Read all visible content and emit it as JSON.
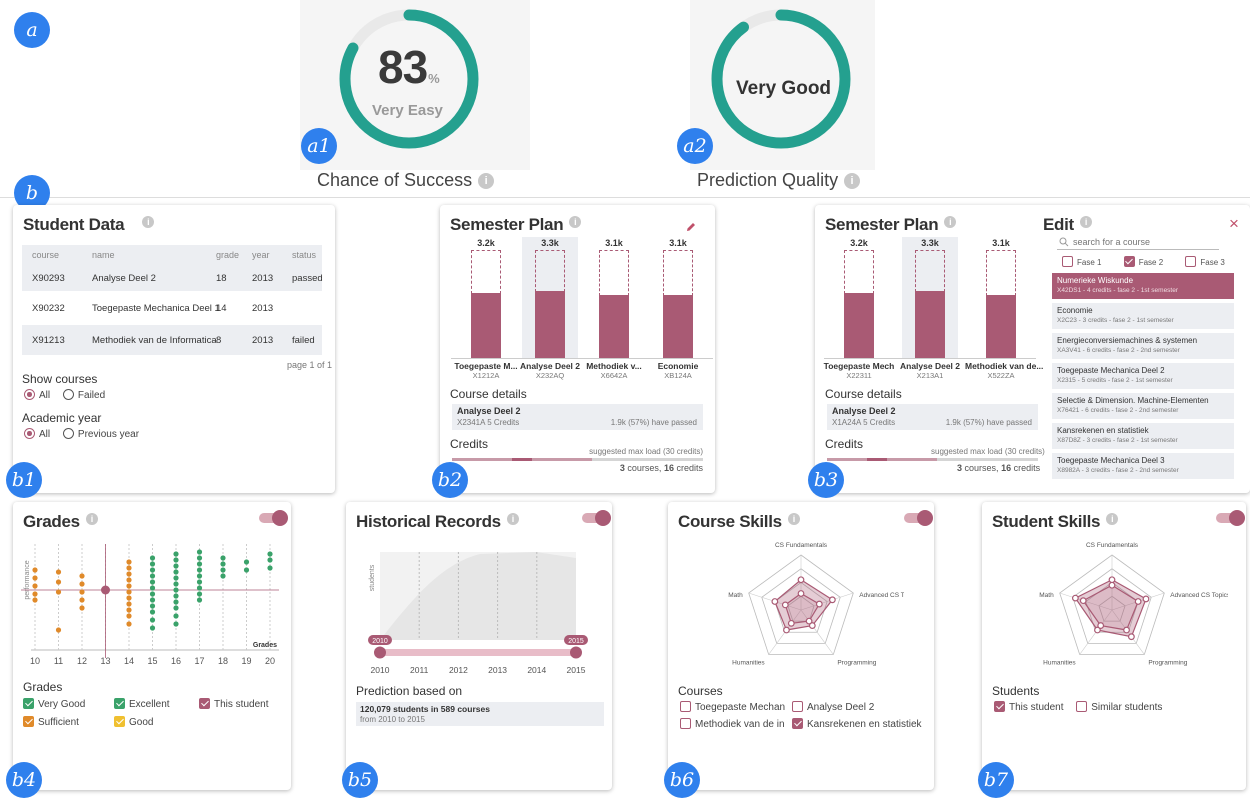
{
  "badges": {
    "a": "a",
    "a1": "a1",
    "a2": "a2",
    "b": "b",
    "b1": "b1",
    "b2": "b2",
    "b3": "b3",
    "b4": "b4",
    "b5": "b5",
    "b6": "b6",
    "b7": "b7"
  },
  "gauges": {
    "success": {
      "value": "83",
      "unit": "%",
      "sublabel": "Very Easy",
      "caption": "Chance of Success",
      "fraction": 0.83
    },
    "quality": {
      "label": "Very Good",
      "caption": "Prediction Quality",
      "fraction": 0.9
    }
  },
  "colors": {
    "accent": "#a95a74",
    "teal": "#24a08f",
    "badge": "#2f80ed"
  },
  "student_data": {
    "title": "Student Data",
    "columns": [
      "course",
      "name",
      "grade",
      "year",
      "status"
    ],
    "rows": [
      [
        "X90293",
        "Analyse Deel 2",
        "18",
        "2013",
        "passed"
      ],
      [
        "X90232",
        "Toegepaste Mechanica Deel 1",
        "14",
        "2013",
        ""
      ],
      [
        "X91213",
        "Methodiek van de Informatica",
        "8",
        "2013",
        "failed"
      ]
    ],
    "pagination": "page 1 of 1",
    "show_courses": "Show courses",
    "opt_all": "All",
    "opt_failed": "Failed",
    "academic_year": "Academic year",
    "opt_previous": "Previous year"
  },
  "semester_plan": {
    "title": "Semester Plan",
    "bars": [
      {
        "top": "3.2k",
        "name": "Toegepaste M...",
        "code": "X1212A",
        "fill": 0.6
      },
      {
        "top": "3.3k",
        "name": "Analyse Deel 2",
        "code": "X232AQ",
        "fill": 0.62
      },
      {
        "top": "3.1k",
        "name": "Methodiek v...",
        "code": "X6642A",
        "fill": 0.58
      },
      {
        "top": "3.1k",
        "name": "Economie",
        "code": "XB124A",
        "fill": 0.58
      }
    ],
    "details_label": "Course details",
    "detail_name": "Analyse Deel 2",
    "detail_code": "X2341A 5 Credits",
    "detail_passed": "1.9k (57%) have passed",
    "credits_label": "Credits",
    "suggested": "suggested max load (30 credits)",
    "courses_count": "3",
    "courses_word": "courses,",
    "credits_count": "16",
    "credits_word": "credits"
  },
  "semester_plan_edit": {
    "title": "Semester Plan",
    "bars": [
      {
        "top": "3.2k",
        "name": "Toegepaste Mech",
        "code": "X22311",
        "fill": 0.6
      },
      {
        "top": "3.3k",
        "name": "Analyse Deel 2",
        "code": "X213A1",
        "fill": 0.62
      },
      {
        "top": "3.1k",
        "name": "Methodiek van de...",
        "code": "X522ZA",
        "fill": 0.58
      }
    ],
    "details_label": "Course details",
    "detail_name": "Analyse Deel 2",
    "detail_code": "X1A24A 5 Credits",
    "detail_passed": "1.9k (57%) have passed",
    "credits_label": "Credits",
    "suggested": "suggested max load (30 credits)",
    "courses_count": "3",
    "courses_word": "courses,",
    "credits_count": "16",
    "credits_word": "credits",
    "edit_title": "Edit",
    "search_placeholder": "search for a course",
    "fase1": "Fase 1",
    "fase2": "Fase 2",
    "fase3": "Fase 3",
    "courses": [
      {
        "name": "Numerieke Wiskunde",
        "desc": "X42DS1 - 4 credits - fase 2 - 1st semester"
      },
      {
        "name": "Economie",
        "desc": "X2C23 - 3 credits - fase 2 - 1st semester"
      },
      {
        "name": "Energieconversiemachines & systemen",
        "desc": "XA3V41 - 6 credits - fase 2 - 2nd semester"
      },
      {
        "name": "Toegepaste Mechanica Deel 2",
        "desc": "X2315 - 5 credits - fase 2 - 1st semester"
      },
      {
        "name": "Selectie & Dimension. Machine-Elementen",
        "desc": "X76421 - 6 credits - fase 2 - 2nd semester"
      },
      {
        "name": "Kansrekenen en statistiek",
        "desc": "X87D8Z - 3 credits - fase 2 - 1st semester"
      },
      {
        "name": "Toegepaste Mechanica Deel 3",
        "desc": "X8982A - 3 credits - fase 2 - 2nd semester"
      }
    ]
  },
  "grades": {
    "title": "Grades",
    "ylabel": "performance",
    "xlabel": "Grades",
    "ticks": [
      "10",
      "11",
      "12",
      "13",
      "14",
      "15",
      "16",
      "17",
      "18",
      "19",
      "20"
    ],
    "legend_title": "Grades",
    "legend": {
      "very_good": "Very Good",
      "excellent": "Excellent",
      "this_student": "This student",
      "sufficient": "Sufficient",
      "good": "Good"
    }
  },
  "historical": {
    "title": "Historical Records",
    "ylabel": "students",
    "years": [
      "2010",
      "2011",
      "2012",
      "2013",
      "2014",
      "2015"
    ],
    "range_start": "2010",
    "range_end": "2015",
    "prediction_label": "Prediction based on",
    "prediction_bold": "120,079 students in 589 courses",
    "prediction_sub": "from 2010 to 2015"
  },
  "course_skills": {
    "title": "Course Skills",
    "axes": [
      "CS Fundamentals",
      "Advanced CS Topics",
      "Programming",
      "Humanities",
      "Math"
    ],
    "values_a": [
      0.55,
      0.6,
      0.35,
      0.45,
      0.5
    ],
    "values_b": [
      0.3,
      0.35,
      0.25,
      0.3,
      0.3
    ],
    "legend_title": "Courses",
    "items": [
      "Toegepaste Mechan",
      "Analyse Deel 2",
      "Methodiek van de in",
      "Kansrekenen en statistiek"
    ],
    "checked": [
      false,
      false,
      false,
      true
    ]
  },
  "student_skills": {
    "title": "Student Skills",
    "axes": [
      "CS Fundamentals",
      "Advanced CS Topics",
      "Programming",
      "Humanities",
      "Math"
    ],
    "values_a": [
      0.55,
      0.65,
      0.6,
      0.45,
      0.7
    ],
    "values_b": [
      0.45,
      0.5,
      0.45,
      0.35,
      0.55
    ],
    "legend_title": "Students",
    "items": [
      "This student",
      "Similar students"
    ]
  }
}
